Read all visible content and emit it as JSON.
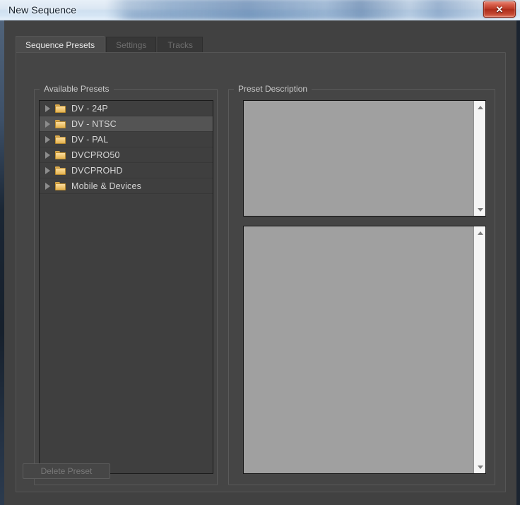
{
  "window": {
    "title": "New Sequence",
    "close_label": "✕",
    "close_icon": "close-icon"
  },
  "tabs": [
    {
      "label": "Sequence Presets",
      "state": "active"
    },
    {
      "label": "Settings",
      "state": "disabled"
    },
    {
      "label": "Tracks",
      "state": "disabled"
    }
  ],
  "available_presets": {
    "legend": "Available Presets",
    "items": [
      {
        "label": "DV - 24P",
        "icon": "folder-icon",
        "selected": false,
        "expanded": false
      },
      {
        "label": "DV - NTSC",
        "icon": "folder-icon",
        "selected": true,
        "expanded": false
      },
      {
        "label": "DV - PAL",
        "icon": "folder-icon",
        "selected": false,
        "expanded": false
      },
      {
        "label": "DVCPRO50",
        "icon": "folder-icon",
        "selected": false,
        "expanded": false
      },
      {
        "label": "DVCPROHD",
        "icon": "folder-icon",
        "selected": false,
        "expanded": false
      },
      {
        "label": "Mobile & Devices",
        "icon": "folder-icon",
        "selected": false,
        "expanded": false
      }
    ]
  },
  "preset_description": {
    "legend": "Preset Description",
    "summary_text": "",
    "details_text": ""
  },
  "footer": {
    "delete_preset_label": "Delete Preset",
    "delete_preset_enabled": false
  },
  "colors": {
    "dialog_background": "#414141",
    "panel_background": "#454545",
    "list_background": "#3f3f3f",
    "list_selection": "#545454",
    "description_background": "#a0a0a0",
    "folder_accent": "#f2cb79",
    "close_button": "#bc3a26",
    "titlebar_glass": "#dbe7f3",
    "text_primary": "#d6d6d6",
    "text_disabled": "#6e6e6e"
  }
}
